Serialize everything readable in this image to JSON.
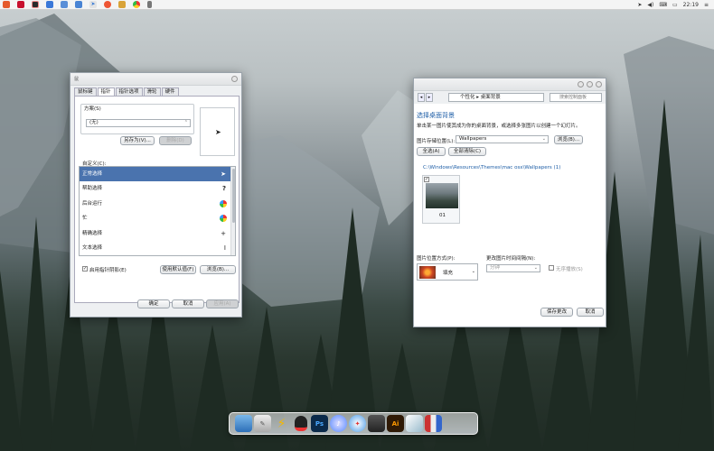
{
  "menubar": {
    "icons": [
      "office-icon",
      "red-app-icon",
      "orange-app-icon",
      "shield-icon",
      "window-icon",
      "document-icon",
      "send-icon",
      "360-icon",
      "folder-icon",
      "chrome-icon",
      "phone-icon"
    ],
    "tray": {
      "time": "22:19"
    }
  },
  "mouse_dialog": {
    "title": "鼠",
    "tabs": [
      "鼠标键",
      "指针",
      "指针选项",
      "滑轮",
      "硬件"
    ],
    "active_tab": 1,
    "scheme_group_label": "方案(S)",
    "scheme_value": "(无)",
    "save_as_label": "另存为(V)...",
    "delete_label": "删除(D)",
    "customize_label": "自定义(C):",
    "cursors": [
      {
        "label": "正常选择",
        "glyph": "arrow"
      },
      {
        "label": "帮助选择",
        "glyph": "?"
      },
      {
        "label": "后台运行",
        "glyph": "wheel"
      },
      {
        "label": "忙",
        "glyph": "wheel"
      },
      {
        "label": "精确选择",
        "glyph": "+"
      },
      {
        "label": "文本选择",
        "glyph": "I"
      }
    ],
    "shadow_label": "启用指针阴影(E)",
    "shadow_checked": "✓",
    "use_default_label": "使用默认值(F)",
    "browse_label": "浏览(B)...",
    "ok_label": "确定",
    "cancel_label": "取消",
    "apply_label": "应用(A)"
  },
  "desktop_bg_window": {
    "address_path": "个性化 ▸ 桌面背景",
    "search_placeholder": "搜索控制面板",
    "heading": "选择桌面背景",
    "description": "单击某一图片使其成为你的桌面背景，或选择多张图片以创建一个幻灯片。",
    "location_label": "图片存储位置(L):",
    "location_value": "Wallpapers",
    "browse_label": "浏览(B)...",
    "select_all_label": "全选(A)",
    "clear_all_label": "全部清除(C)",
    "folder_path": "C:\\Windows\\Resources\\Themes\\mac osx\\Wallpapers (1)",
    "thumb_label": "01",
    "position_label": "图片位置方式(P):",
    "position_value": "填充",
    "interval_label": "更改图片时间间隔(N):",
    "interval_value": "分钟",
    "shuffle_label": "无序播放(S)",
    "save_label": "保存更改",
    "cancel_label": "取消"
  },
  "dock": {
    "items": [
      "finder-icon",
      "tools-icon",
      "winamp-icon",
      "qq-icon",
      "photoshop-icon",
      "itunes-icon",
      "safari-icon",
      "contacts-icon",
      "illustrator-icon",
      "cube-icon",
      "books-icon"
    ],
    "ai_text": "Ai",
    "ps_text": "Ps"
  },
  "colors": {
    "accent": "#4a73ae",
    "link_blue": "#1f5fa7"
  }
}
